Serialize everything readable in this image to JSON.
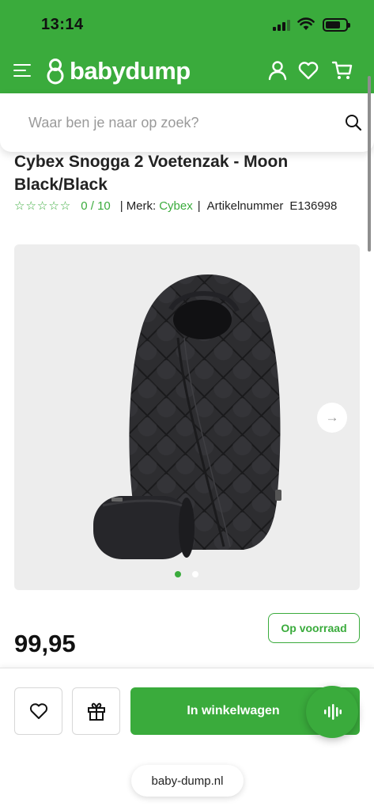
{
  "status_bar": {
    "time": "13:14"
  },
  "header": {
    "brand": "babydump",
    "menu_icon": "hamburger-menu-icon",
    "account_icon": "user-icon",
    "wishlist_icon": "heart-icon",
    "cart_icon": "cart-icon",
    "background_color": "#3aab3c"
  },
  "search": {
    "placeholder": "Waar ben je naar op zoek?"
  },
  "product": {
    "title": "Cybex Snogga 2 Voetenzak - Moon Black/Black",
    "stars": "☆☆☆☆☆",
    "rating": "0 / 10",
    "brand_label": "Merk:",
    "brand": "Cybex",
    "article_label": "Artikelnummer",
    "article_number": "E136998",
    "stock_status": "Op voorraad",
    "price": "99,95"
  },
  "gallery": {
    "next_icon": "arrow-right-icon",
    "slide_count": 2,
    "active_slide": 1
  },
  "actions": {
    "wishlist_icon": "heart-icon",
    "gift_icon": "gift-icon",
    "add_to_cart": "In winkelwagen",
    "voice_icon": "voice-wave-icon"
  },
  "browser": {
    "url": "baby-dump.nl"
  },
  "colors": {
    "accent": "#3aab3c",
    "gallery_bg": "#ededed",
    "product_dark": "#2b2b2d"
  }
}
